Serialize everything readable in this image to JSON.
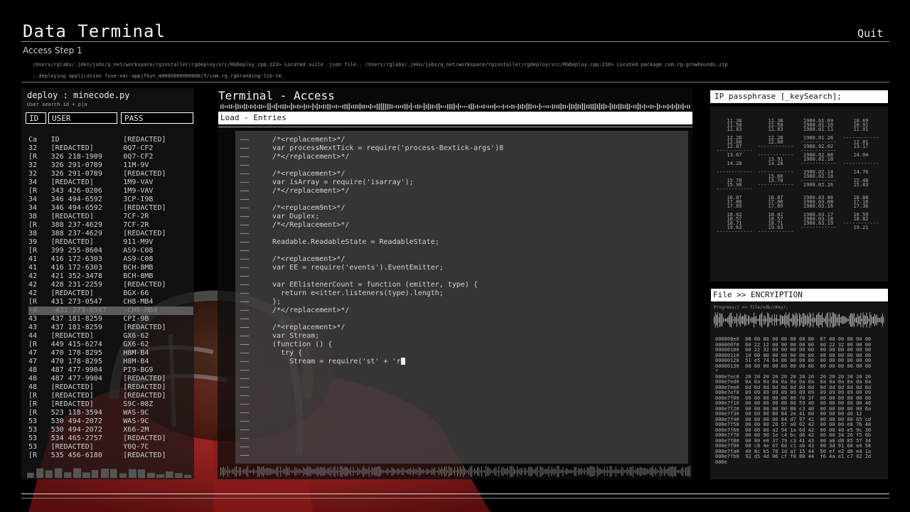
{
  "header": {
    "title": "Data Terminal",
    "quit_label": "Quit",
    "step_label": "Access Step 1"
  },
  "log": {
    "line1": "/Users/rglabs/.jekn/jobs/q_net/workspace/rginstaller/rgdeploy/src/RGDeploy.cpp:223> Located suite .json file.. /Users/rglabs/.jekn/jobs/q_net/workspace/rginstaller/rgdeploy/src/RGDeploy.cpp:210> Located package com.rg.growbounds.zip",
    "line2": "..deploying application fuse-nac-appjfbyn_m0000000000000/T/com.rg.rgbranding-lib-tm_"
  },
  "left_panel": {
    "title": "deploy : minecode.py",
    "subtitle": "User search id + p|a",
    "col_id": "ID",
    "col_user": "USER",
    "col_pass": "PASS",
    "rows": [
      [
        "Ca",
        "ID",
        "[REDACTED]"
      ],
      [
        "32",
        "[REDACTED]",
        "0Q7-CF2"
      ],
      [
        "[R",
        "326 218-1909",
        "0Q7-CF2"
      ],
      [
        "32",
        "326 291-0789",
        "11M-9V"
      ],
      [
        "32",
        "326 291-0789",
        "[REDACTED]"
      ],
      [
        "34",
        "[REDACTED]",
        "1M9-VAV"
      ],
      [
        "[R",
        "343 426-0206",
        "1M9-VAV"
      ],
      [
        "34",
        "346 494-6592",
        "3CP-I9B"
      ],
      [
        "34",
        "346 494-6592",
        "[REDACTED]"
      ],
      [
        "38",
        "[REDACTED]",
        "7CF-2R"
      ],
      [
        "[R",
        "388 237-4629",
        "7CF-2R"
      ],
      [
        "38",
        "388 237-4629",
        "[REDACTED]"
      ],
      [
        "39",
        "[REDACTED]",
        "911-M9V"
      ],
      [
        "[R",
        "399 255-8604",
        "AS9-C08"
      ],
      [
        "41",
        "416 172-6303",
        "AS9-C08"
      ],
      [
        "41",
        "416 172-6303",
        "BCH-8MB"
      ],
      [
        "42",
        "421 352-3478",
        "BCH-8MB"
      ],
      [
        "42",
        "428 231-2259",
        "[REDACTED]"
      ],
      [
        "42",
        "[REDACTED]",
        "BGX-66"
      ],
      [
        "[R",
        "431 273-0547",
        "CH8-MB4"
      ],
      [
        "-4",
        "-431 273-0547",
        "-CH8-MB4"
      ],
      [
        "43",
        "437 181-8259",
        "CPI-9B"
      ],
      [
        "43",
        "437 181-8259",
        "[REDACTED]"
      ],
      [
        "44",
        "[REDACTED]",
        "GX6-62"
      ],
      [
        "[R",
        "449 415-6274",
        "GX6-62"
      ],
      [
        "47",
        "470 178-8295",
        "H8M-B4"
      ],
      [
        "47",
        "470 178-8295",
        "H8M-B4"
      ],
      [
        "48",
        "487 477-9904",
        "PI9-BG9"
      ],
      [
        "48",
        "487 477-9904",
        "[REDACTED]"
      ],
      [
        "48",
        "[REDACTED]",
        "[REDACTED]"
      ],
      [
        "[R",
        "[REDACTED]",
        "[REDACTED]"
      ],
      [
        "[R",
        "[REDACTED]",
        "S9C-08Z"
      ],
      [
        "[R",
        "523 118-3594",
        "WAS-9C"
      ],
      [
        "53",
        "530 494-2072",
        "WAS-9C"
      ],
      [
        "53",
        "530 494-2072",
        "X66-2M"
      ],
      [
        "53",
        "534 465-2757",
        "[REDACTED]"
      ],
      [
        "53",
        "[REDACTED]",
        "Y0Q-7C"
      ],
      [
        "[R",
        "535 456-6180",
        "[REDACTED]"
      ]
    ]
  },
  "terminal": {
    "title": "Terminal - Access",
    "load_label": "Load - Entries",
    "lines": [
      "/*<replacement>*/",
      "var processNextTick = require('process-Bextick-args')8",
      "/*</replacement>*/",
      "",
      "/*<replacement>*/",
      "var isArray = require('isarray');",
      "/*</replacement>*/",
      "",
      "/*<replacem9nt>*/",
      "var Duplex;",
      "/*</Replacement>*/",
      "",
      "Readable.ReadableState = ReadableState;",
      "",
      "/*<replacement>*/",
      "var EE = require('events').EventEmitter;",
      "",
      "var EElistenerCount = function (emitter, type) {",
      "  return e<itter.listeners(type).length;",
      "};",
      "/*</replacement>*/",
      "",
      "/*<replacement>*/",
      "var Stream;",
      "(function () {",
      "  try {",
      "    Stream = require('st' + 'r",
      "",
      "",
      "",
      "",
      "",
      "",
      "",
      "",
      "",
      "",
      ""
    ],
    "dash": "——"
  },
  "ip_panel": {
    "title": "IP passphrase [_keySearch];",
    "rows": [
      [
        "11.38",
        "11.38",
        "1980.01.09",
        "10.69"
      ],
      [
        "11.50",
        "11.50",
        "1980.01.10",
        "10.91"
      ],
      [
        "11.83",
        "11.83",
        "1980.01.11",
        "11.01"
      ],
      [
        "",
        "",
        "",
        ""
      ],
      [
        "12.28",
        "12.28",
        "1980.01.26",
        "------------"
      ],
      [
        "12.68",
        "12.68",
        "------------",
        "12.81"
      ],
      [
        "12.87",
        "------------",
        "1980.02.02",
        "13.17"
      ],
      [
        "------------",
        "",
        "------------",
        ""
      ],
      [
        "13.67",
        "------------",
        "1980.02.08",
        "14.04"
      ],
      [
        "",
        "13.91",
        "1980.02.10",
        ""
      ],
      [
        "14.28",
        "14.28",
        "------------",
        "------------"
      ],
      [
        "",
        "",
        "",
        ""
      ],
      [
        "------------",
        "------------",
        "1980.02.14",
        "14.76"
      ],
      [
        "",
        "15.60",
        "1980.02.18",
        ""
      ],
      [
        "15.70",
        "15.70",
        "------------",
        "15.48"
      ],
      [
        "15.98",
        "------------",
        "1980.02.26",
        "15.83"
      ],
      [
        "------------",
        "",
        "",
        ""
      ],
      [
        "",
        "",
        "",
        ""
      ],
      [
        "16.87",
        "16.87",
        "1980.03.06",
        "16.88"
      ],
      [
        "17.88",
        "17.88",
        "1980.03.08",
        "17.16"
      ],
      [
        "17.89",
        "17.89",
        "1980.03.16",
        "17.36"
      ],
      [
        "",
        "",
        "",
        ""
      ],
      [
        "18.02",
        "18.02",
        "1980.03.17",
        "18.59"
      ],
      [
        "18.57",
        "18.57",
        "1980.03.18",
        "18.82"
      ],
      [
        "18.71",
        "18.71",
        "1980.03.19",
        "------------"
      ],
      [
        "19.63",
        "19.63",
        "------------",
        "19.21"
      ],
      [
        "------------",
        "------------",
        "",
        ""
      ]
    ]
  },
  "file_panel": {
    "title": "File >> ENCRYIPTION",
    "progress_label": "Progress// >> file/vdb//Key/;",
    "hex_lines": [
      "000000e0  08 00 00 00 00 00 00 00  07 00 00 00 04 00",
      "000000f0  60 22 12 00 00 00 00 00  60 22 32 00 00 00",
      "00000100  60 22 32 00 00 00 00 00  00 00 00 00 00 00",
      "00000110  10 00 00 00 00 00 00 00  08 00 00 00 00 00",
      "00000120  51 e5 74 64 06 00 00 00  00 00 00 00 00 00",
      "00000130  00 00 00 00 00 00 00 00  00 00 00 00 00 00",
      "*",
      "000e7ec0  20 20 20 20 20 20 20 20  20 20 20 20 20 20",
      "000e7ed0  0a 0a 0a 0a 0a 0a 0a 0a  0a 0a 0a 0a 0a 0a",
      "000e7ee0  0d 0d 0d 0d 0d 0d 0d 0d  0d 0d 0d 0d 0d 0d",
      "000e7ef0  09 09 09 09 09 09 09 09  09 09 09 09 09 09",
      "000e7f00  00 00 00 00 00 00 f0 3f  00 00 00 00 00 00",
      "000e7f10  00 00 00 00 00 00 59 40  00 00 00 00 00 40",
      "000e7f20  00 00 00 00 00 88 c3 40  00 00 00 00 00 6a",
      "000e7f30  00 00 00 80 84 2e 41 00  00 00 00 d0 12",
      "000e7f40  00 00 00 00 84 d7 97 41  00 00 00 00 65 cd",
      "000e7f50  00 00 00 20 5f a0 02 42  00 00 00 e8 76 48",
      "000e7f60  00 00 00 a2 94 1a 6d 42  00 00 40 e5 9c 30",
      "000e7f70  00 00 90 1e c4 bc d6 42  00 00 34 26 f5 6b",
      "000e7f80  00 80 e0 37 79 c3 41 43  00 a0 d8 85 57 34",
      "000e7f90  00 c8 4e 67 6d c1 ab 43  00 3d 91 60 e4 58",
      "000e7fa0  40 8c b5 78 1d af 15 44  50 ef e2 d6 e4 1a",
      "000e7fb0  92 d5 4d 06 cf f0 80 44  f6 4a e1 c7 02 2d",
      "000e"
    ]
  }
}
